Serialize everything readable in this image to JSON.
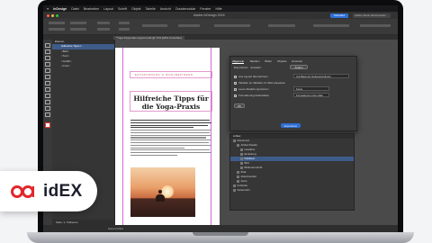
{
  "menubar": {
    "app_name": "InDesign",
    "items": [
      "Datei",
      "Bearbeiten",
      "Layout",
      "Schrift",
      "Objekt",
      "Tabelle",
      "Ansicht",
      "Zusatzmodule",
      "Fenster",
      "Hilfe"
    ],
    "right": ""
  },
  "window": {
    "title": "Adobe InDesign 2024"
  },
  "workspace_button": "Standard",
  "search_placeholder": "Adobe Stock durchsuchen",
  "document_tab": "*Yoga-Tipps-Idex-Layout.indd @ 71% [GPU-Vorschau]",
  "layers_panel": {
    "title": "Ebenen",
    "rows": [
      "Hilfreiche Tipps f...",
      "<Bild>",
      "<Text>",
      "<Grafik>",
      "<Linie>"
    ],
    "footer": "Seite: 1, 5 Ebenen"
  },
  "page": {
    "kicker": "ENTSPANNUNG & WOHLBEFINDEN",
    "headline": "Hilfreiche Tipps für die Yoga-Praxis"
  },
  "dialog": {
    "tabs": [
      "Allgemein",
      "Tabellen",
      "Bilder",
      "Objekte",
      "Erweitert"
    ],
    "active_tab": "Allgemein",
    "export_label": "Exportieren:",
    "export_value": "Auswahl",
    "export_button": "Ändern",
    "options": [
      "Aus Layout übernehmen",
      "Tabellen an Tabellen im Web anpassen",
      "Leere Absätze ignorieren",
      "Formatierung beibehalten"
    ],
    "select_values": [
      "Auf Basis der Seitenanordnung",
      "Keine",
      "Formatierung ohne Stile"
    ],
    "done_button": "OK",
    "ok_button": "Exportieren"
  },
  "styles_panel": {
    "title": "Artikel",
    "rows": [
      "Dokument",
      "Artikel Details",
      "Headline",
      "Einleitung",
      "Fließtext",
      "Bild",
      "Bildunterschrift",
      "Zitat",
      "Zwischentitel",
      "Autor",
      "Fußzeile",
      "Seitenzahl"
    ]
  },
  "status_bar": "Keine Fehler",
  "brand": {
    "name": "idEX"
  },
  "colors": {
    "accent": "#2d6fd6",
    "guide": "#d06ad6",
    "logo_red": "#e3262b"
  }
}
